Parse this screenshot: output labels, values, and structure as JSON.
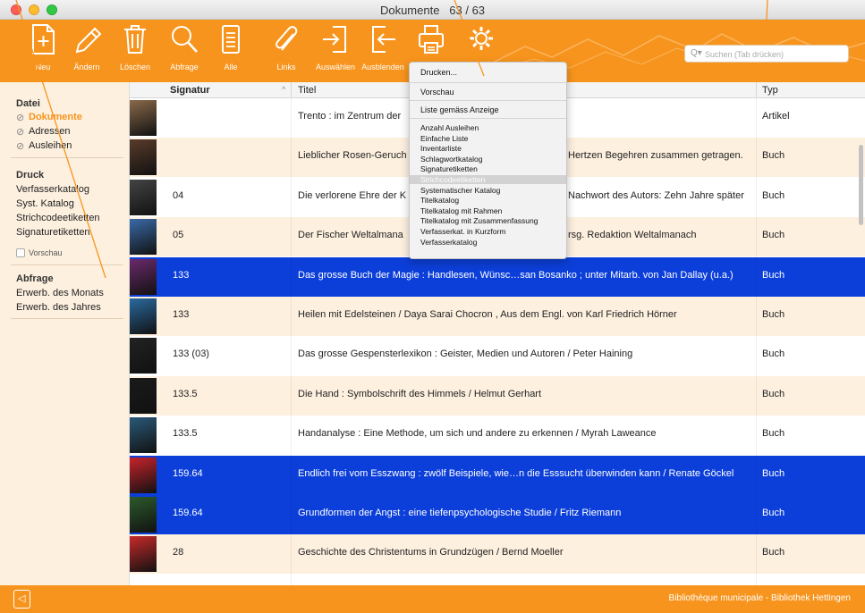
{
  "window": {
    "title": "Dokumente",
    "count": "63 / 63"
  },
  "toolbar": {
    "buttons": [
      {
        "label": "Neu",
        "icon": "new-document-icon"
      },
      {
        "label": "Ändern",
        "icon": "pencil-icon"
      },
      {
        "label": "Löschen",
        "icon": "trash-icon"
      },
      {
        "label": "Abfrage",
        "icon": "magnifier-icon"
      },
      {
        "label": "Alle",
        "icon": "document-list-icon"
      },
      {
        "label": "Links",
        "icon": "paperclip-icon"
      },
      {
        "label": "Auswählen",
        "icon": "select-arrow-icon"
      },
      {
        "label": "Ausblenden",
        "icon": "hide-arrow-icon"
      },
      {
        "label": "",
        "icon": "printer-icon"
      },
      {
        "label": "",
        "icon": "gear-icon"
      }
    ],
    "search_placeholder": "Suchen (Tab drücken)"
  },
  "sidebar": {
    "datei": {
      "heading": "Datei",
      "items": [
        {
          "label": "Dokumente",
          "active": true
        },
        {
          "label": "Adressen",
          "active": false
        },
        {
          "label": "Ausleihen",
          "active": false
        }
      ]
    },
    "druck": {
      "heading": "Druck",
      "items": [
        "Verfasserkatalog",
        "Syst. Katalog",
        "Strichcodeetiketten",
        "Signaturetiketten"
      ],
      "vorschau": "Vorschau"
    },
    "abfrage": {
      "heading": "Abfrage",
      "items": [
        "Erwerb. des Monats",
        "Erwerb. des Jahres"
      ]
    }
  },
  "table": {
    "columns": {
      "signatur": "Signatur",
      "titel": "Titel",
      "typ": "Typ"
    },
    "rows": [
      {
        "signatur": "",
        "titel": "Trento : im Zentrum der",
        "typ": "Artikel",
        "selected": false,
        "thumb": "#8a6a4a"
      },
      {
        "signatur": "",
        "titel": "Lieblicher Rosen-Geruch",
        "typ": "Buch",
        "selected": false,
        "thumb": "#5a3b2a",
        "titel_end": "Hertzen Begehren zusammen getragen."
      },
      {
        "signatur": "04",
        "titel": "Die verlorene Ehre der K",
        "typ": "Buch",
        "selected": false,
        "thumb": "#444444",
        "titel_end": "Nachwort des Autors: Zehn Jahre später"
      },
      {
        "signatur": "05",
        "titel": "Der Fischer Weltalmana",
        "typ": "Buch",
        "selected": false,
        "thumb": "#3a6aa8",
        "titel_end": "rsg. Redaktion Weltalmanach"
      },
      {
        "signatur": "133",
        "titel": "Das grosse Buch der Magie : Handlesen, Wünsc…san Bosanko ; unter Mitarb. von Jan Dallay (u.a.)",
        "typ": "Buch",
        "selected": true,
        "thumb": "#6b2a6b"
      },
      {
        "signatur": "133",
        "titel": "Heilen mit Edelsteinen / Daya Sarai Chocron , Aus dem Engl. von Karl Friedrich Hörner",
        "typ": "Buch",
        "selected": false,
        "thumb": "#2a6aa0"
      },
      {
        "signatur": "133 (03)",
        "titel": "Das grosse Gespensterlexikon : Geister, Medien und Autoren / Peter Haining",
        "typ": "Buch",
        "selected": false,
        "thumb": "#222222"
      },
      {
        "signatur": "133.5",
        "titel": "Die Hand : Symbolschrift des Himmels / Helmut Gerhart",
        "typ": "Buch",
        "selected": false,
        "thumb": "#1a1a1a"
      },
      {
        "signatur": "133.5",
        "titel": "Handanalyse : Eine Methode, um sich und andere zu erkennen / Myrah Laweance",
        "typ": "Buch",
        "selected": false,
        "thumb": "#2a5a7a"
      },
      {
        "signatur": "159.64",
        "titel": "Endlich frei vom Esszwang : zwölf Beispiele, wie…n die Esssucht überwinden kann / Renate Göckel",
        "typ": "Buch",
        "selected": true,
        "thumb": "#c8232b"
      },
      {
        "signatur": "159.64",
        "titel": "Grundformen der Angst : eine tiefenpsychologische Studie / Fritz Riemann",
        "typ": "Buch",
        "selected": true,
        "thumb": "#2c5a2c"
      },
      {
        "signatur": "28",
        "titel": "Geschichte des Christentums in Grundzügen / Bernd Moeller",
        "typ": "Buch",
        "selected": false,
        "thumb": "#c82a2a"
      }
    ]
  },
  "print_menu": {
    "group1": [
      "Drucken..."
    ],
    "group2": [
      "Vorschau"
    ],
    "group3": [
      "Liste gemäss Anzeige"
    ],
    "group4": [
      "Anzahl Ausleihen",
      "Einfache Liste",
      "Inventarliste",
      "Schlagwortkatalog",
      "Signaturetiketten",
      "Strichcodeetiketten",
      "Systematischer Katalog",
      "Titelkatalog",
      "Titelkatalog mit Rahmen",
      "Titelkatalog mit Zusammenfassung",
      "Verfasserkat. in Kurzform",
      "Verfasserkatalog"
    ],
    "highlighted": "Strichcodeetiketten"
  },
  "footer": {
    "library": "Bibliothèque municipale - Bibliothek Hettingen"
  },
  "colors": {
    "accent": "#f7941d",
    "selection": "#0c3fd9",
    "sidebar_bg": "#fdf0df"
  }
}
